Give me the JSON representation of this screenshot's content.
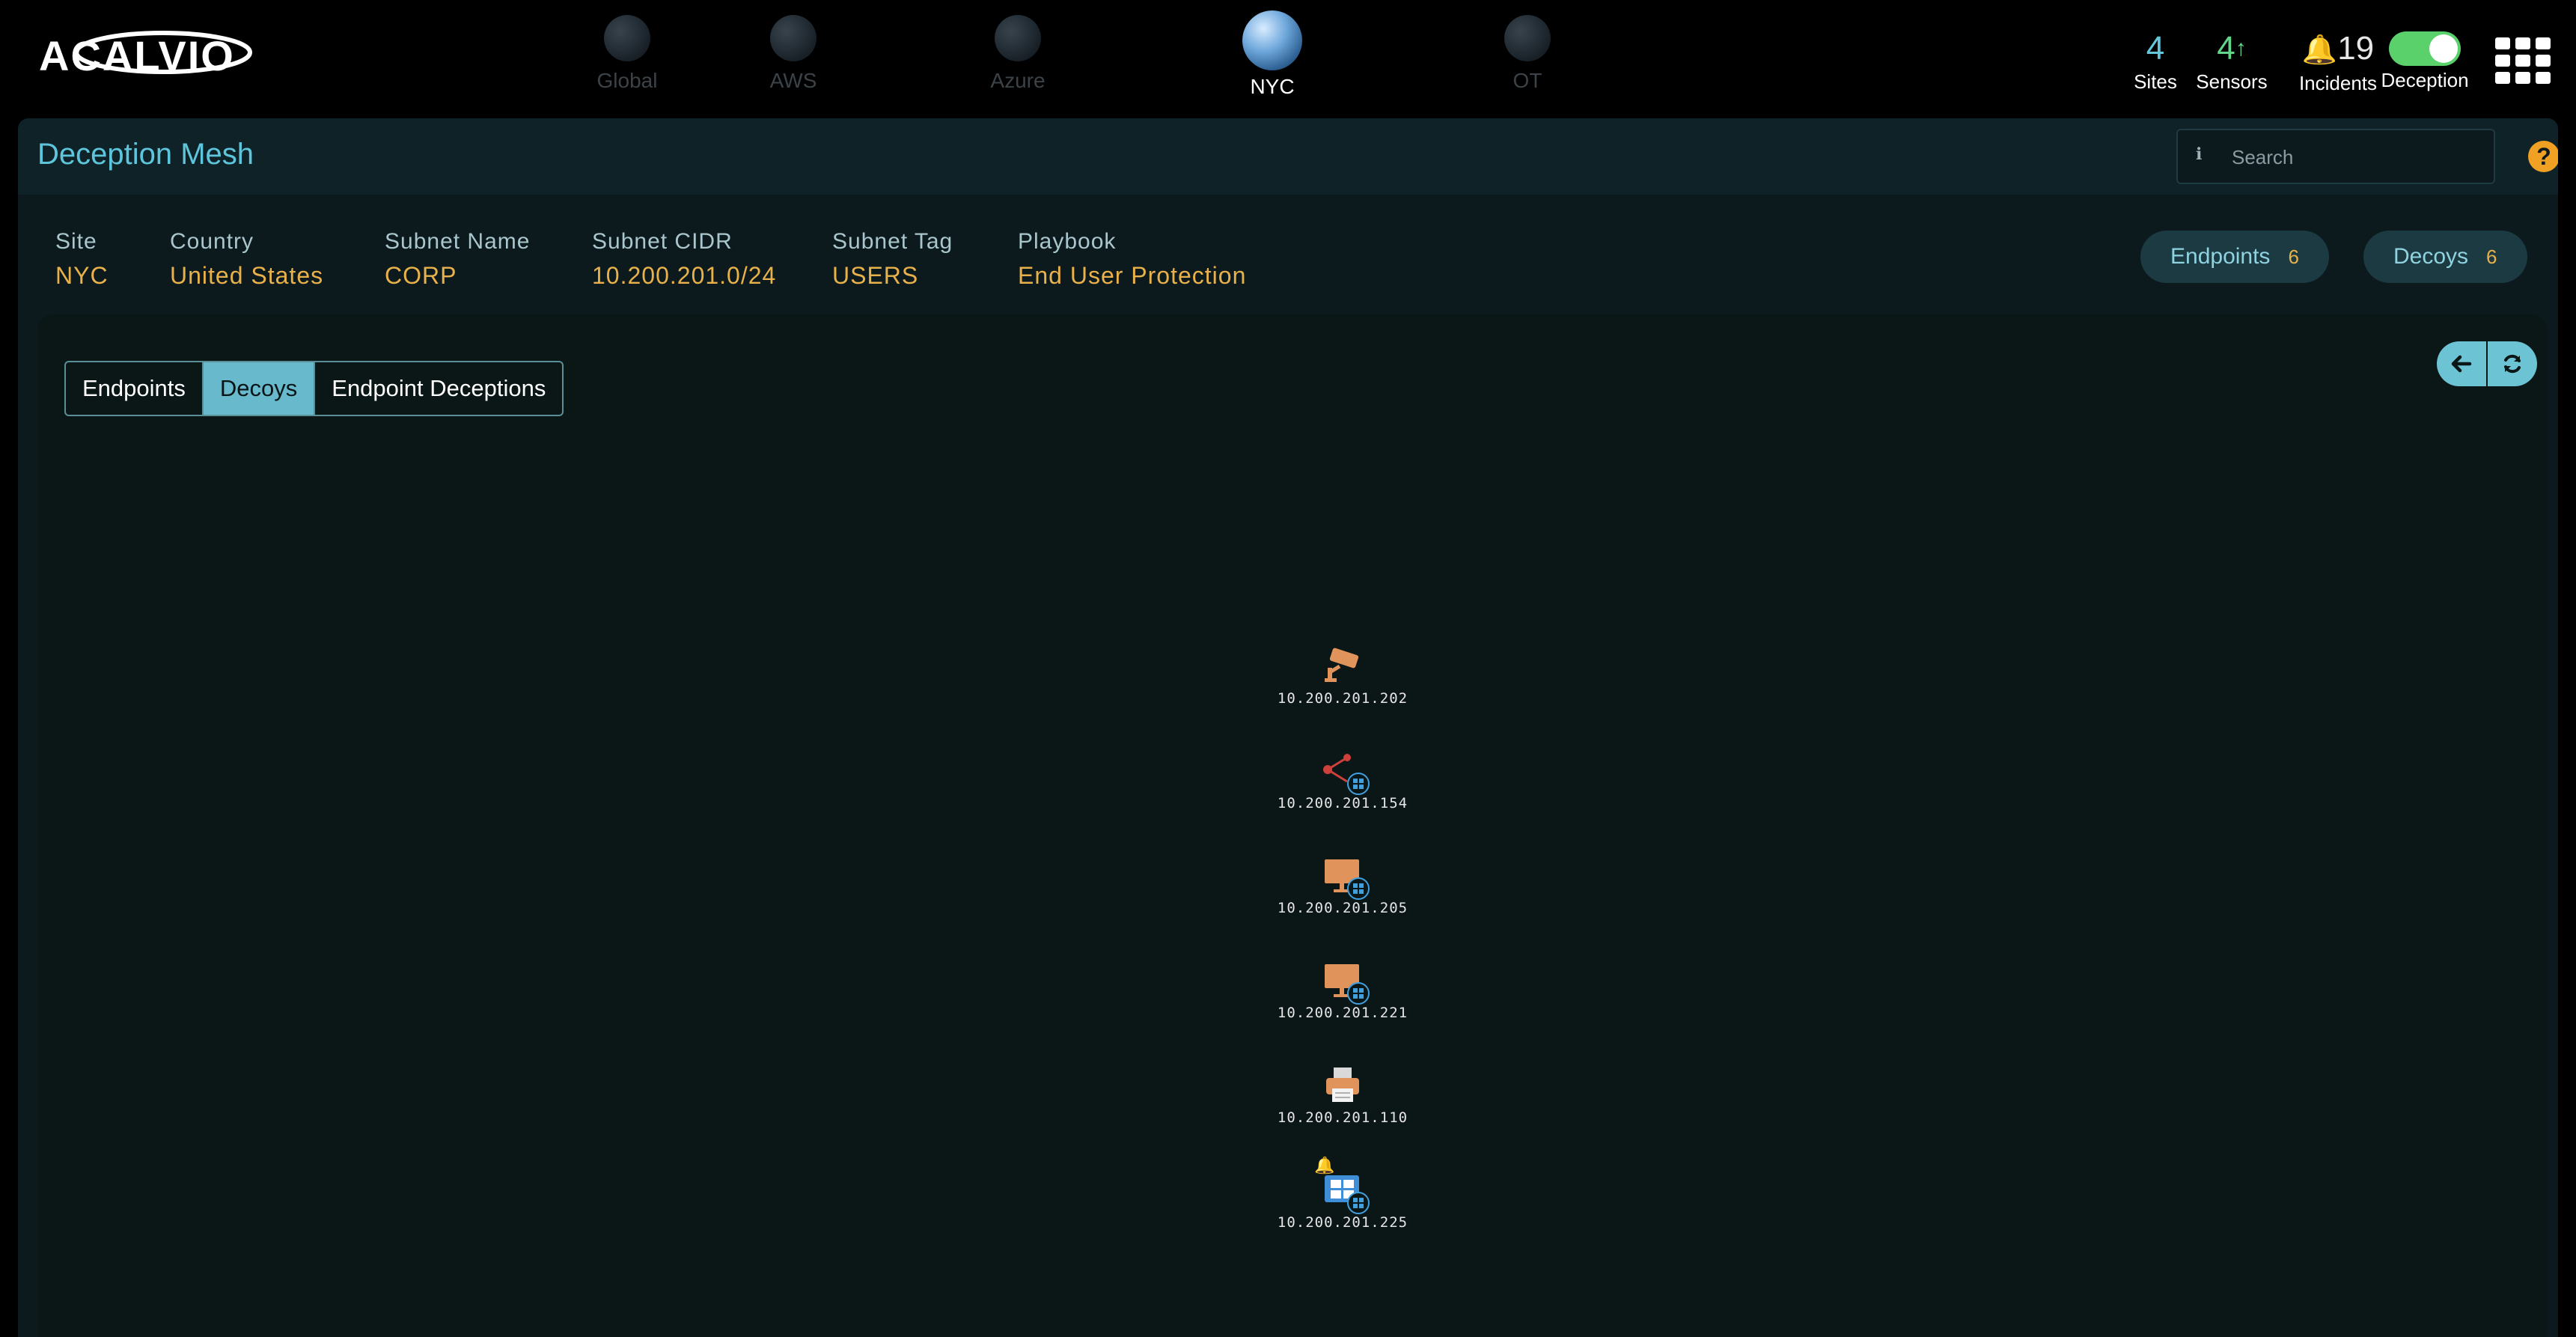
{
  "app": {
    "logo_text": "ACALVIO"
  },
  "sites": [
    {
      "label": "Global",
      "active": false
    },
    {
      "label": "AWS",
      "active": false
    },
    {
      "label": "Azure",
      "active": false
    },
    {
      "label": "NYC",
      "active": true
    },
    {
      "label": "OT",
      "active": false
    }
  ],
  "stats": {
    "sites": {
      "value": "4",
      "label": "Sites"
    },
    "sensors": {
      "value": "4",
      "label": "Sensors",
      "trend_icon": "arrow-up-icon"
    },
    "incidents": {
      "value": "19",
      "label": "Incidents",
      "icon": "bell-icon"
    },
    "deception": {
      "label": "Deception",
      "enabled": true
    }
  },
  "header": {
    "title": "Deception Mesh",
    "search_placeholder": "Search",
    "help_glyph": "?"
  },
  "info": {
    "site": {
      "label": "Site",
      "value": "NYC"
    },
    "country": {
      "label": "Country",
      "value": "United States"
    },
    "subnet_name": {
      "label": "Subnet Name",
      "value": "CORP"
    },
    "subnet_cidr": {
      "label": "Subnet CIDR",
      "value": "10.200.201.0/24"
    },
    "subnet_tag": {
      "label": "Subnet Tag",
      "value": "USERS"
    },
    "playbook": {
      "label": "Playbook",
      "value": "End User Protection"
    }
  },
  "counters": {
    "endpoints": {
      "label": "Endpoints",
      "count": "6"
    },
    "decoys": {
      "label": "Decoys",
      "count": "6"
    }
  },
  "view_tabs": [
    {
      "label": "Endpoints",
      "active": false
    },
    {
      "label": "Decoys",
      "active": true
    },
    {
      "label": "Endpoint Deceptions",
      "active": false
    }
  ],
  "decoys": [
    {
      "ip": "10.200.201.202",
      "icon": "security-camera-icon"
    },
    {
      "ip": "10.200.201.154",
      "icon": "network-node-icon",
      "os": "windows"
    },
    {
      "ip": "10.200.201.205",
      "icon": "monitor-icon",
      "os": "windows"
    },
    {
      "ip": "10.200.201.221",
      "icon": "monitor-icon",
      "os": "windows"
    },
    {
      "ip": "10.200.201.110",
      "icon": "printer-icon"
    },
    {
      "ip": "10.200.201.225",
      "icon": "windows-server-icon",
      "os": "windows",
      "alert": true
    }
  ],
  "colors": {
    "accent": "#5ec6dc",
    "value": "#e8b14a",
    "toggle_on": "#5ad16a",
    "decoy_icon": "#e0935a",
    "panel_bg": "#0c1a1e"
  }
}
